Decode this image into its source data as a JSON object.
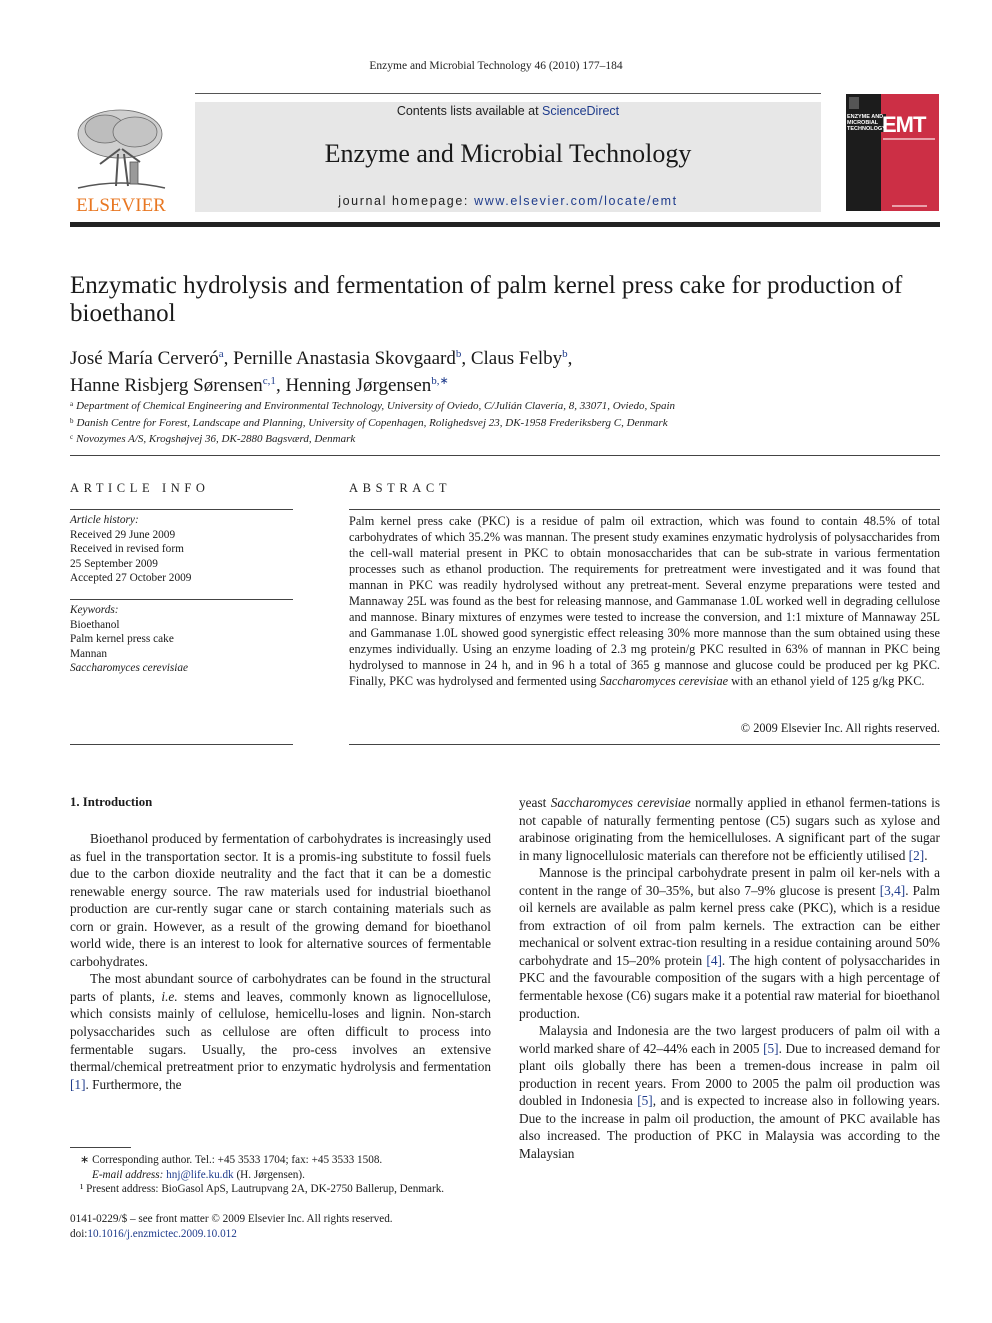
{
  "header": {
    "running_head": "Enzyme and Microbial Technology 46 (2010) 177–184",
    "contents_prefix": "Contents lists available at ",
    "contents_link": "ScienceDirect",
    "journal_title": "Enzyme and Microbial Technology",
    "homepage_prefix": "journal homepage: ",
    "homepage_url": "www.elsevier.com/locate/emt",
    "publisher_logo_text": "ELSEVIER",
    "cover": {
      "label_lines": [
        "ENZYME AND",
        "MICROBIAL",
        "TECHNOLOGY"
      ],
      "abbrev": "EMT",
      "colors": {
        "red": "#cc2f45",
        "dark": "#1c1c1c"
      }
    }
  },
  "colors": {
    "link": "#1f3c8c",
    "elsevier_orange": "#e87722"
  },
  "article": {
    "title": "Enzymatic hydrolysis and fermentation of palm kernel press cake for production of bioethanol",
    "authors": [
      {
        "name": "José María Cerveró",
        "sup": "a",
        "sep": ", "
      },
      {
        "name": "Pernille Anastasia Skovgaard",
        "sup": "b",
        "sep": ", "
      },
      {
        "name": "Claus Felby",
        "sup": "b",
        "sep": ","
      },
      {
        "name": "Hanne Risbjerg Sørensen",
        "sup": "c,1",
        "sep": ", "
      },
      {
        "name": "Henning Jørgensen",
        "sup": "b,∗",
        "sep": ""
      }
    ],
    "affiliations": [
      {
        "key": "a",
        "text": "Department of Chemical Engineering and Environmental Technology, University of Oviedo, C/Julián Clavería, 8, 33071, Oviedo, Spain"
      },
      {
        "key": "b",
        "text": "Danish Centre for Forest, Landscape and Planning, University of Copenhagen, Rolighedsvej 23, DK-1958 Frederiksberg C, Denmark"
      },
      {
        "key": "c",
        "text": "Novozymes A/S, Krogshøjvej 36, DK-2880 Bagsværd, Denmark"
      }
    ]
  },
  "article_info": {
    "heading": "ARTICLE INFO",
    "history_label": "Article history:",
    "history": [
      "Received 29 June 2009",
      "Received in revised form",
      "25 September 2009",
      "Accepted 27 October 2009"
    ],
    "keywords_label": "Keywords:",
    "keywords": [
      "Bioethanol",
      "Palm kernel press cake",
      "Mannan",
      "Saccharomyces cerevisiae"
    ]
  },
  "abstract": {
    "heading": "ABSTRACT",
    "part1": "Palm kernel press cake (PKC) is a residue of palm oil extraction, which was found to contain 48.5% of total carbohydrates of which 35.2% was mannan. The present study examines enzymatic hydrolysis of polysaccharides from the cell-wall material present in PKC to obtain monosaccharides that can be sub-strate in various fermentation processes such as ethanol production. The requirements for pretreatment were investigated and it was found that mannan in PKC was readily hydrolysed without any pretreat-ment. Several enzyme preparations were tested and Mannaway 25L was found as the best for releasing mannose, and Gammanase 1.0L worked well in degrading cellulose and mannose. Binary mixtures of enzymes were tested to increase the conversion, and 1:1 mixture of Mannaway 25L and Gammanase 1.0L showed good synergistic effect releasing 30% more mannose than the sum obtained using these enzymes individually. Using an enzyme loading of 2.3 mg protein/g PKC resulted in 63% of mannan in PKC being hydrolysed to mannose in 24 h, and in 96 h a total of 365 g mannose and glucose could be produced per kg PKC. Finally, PKC was hydrolysed and fermented using ",
    "italic": "Saccharomyces cerevisiae",
    "part2": " with an ethanol yield of 125 g/kg PKC.",
    "copyright": "© 2009 Elsevier Inc. All rights reserved."
  },
  "body": {
    "section_heading": "1.  Introduction",
    "left": {
      "p1": "Bioethanol produced by fermentation of carbohydrates is increasingly used as fuel in the transportation sector. It is a promis-ing substitute to fossil fuels due to the carbon dioxide neutrality and the fact that it can be a domestic renewable energy source. The raw materials used for industrial bioethanol production are cur-rently sugar cane or starch containing materials such as corn or grain. However, as a result of the growing demand for bioethanol world wide, there is an interest to look for alternative sources of fermentable carbohydrates.",
      "p2_a": "The most abundant source of carbohydrates can be found in the structural parts of plants, ",
      "p2_ie": "i.e.",
      "p2_b": " stems and leaves, commonly known as lignocellulose, which consists mainly of cellulose, hemicellu-loses and lignin. Non-starch polysaccharides such as cellulose are often difficult to process into fermentable sugars. Usually, the pro-cess involves an extensive thermal/chemical pretreatment prior to enzymatic hydrolysis and fermentation ",
      "p2_ref": "[1]",
      "p2_c": ". Furthermore, the"
    },
    "right": {
      "p1_a": "yeast ",
      "p1_italic": "Saccharomyces cerevisiae",
      "p1_b": " normally applied in ethanol fermen-tations is not capable of naturally fermenting pentose (C5) sugars such as xylose and arabinose originating from the hemicelluloses. A significant part of the sugar in many lignocellulosic materials can therefore not be efficiently utilised ",
      "p1_ref": "[2]",
      "p1_c": ".",
      "p2_a": "Mannose is the principal carbohydrate present in palm oil ker-nels with a content in the range of 30–35%, but also 7–9% glucose is present ",
      "p2_ref1": "[3,4]",
      "p2_b": ". Palm oil kernels are available as palm kernel press cake (PKC), which is a residue from extraction of oil from palm kernels. The extraction can be either mechanical or solvent extrac-tion resulting in a residue containing around 50% carbohydrate and 15–20% protein ",
      "p2_ref2": "[4]",
      "p2_c": ". The high content of polysaccharides in PKC and the favourable composition of the sugars with a high percentage of fermentable hexose (C6) sugars make it a potential raw material for bioethanol production.",
      "p3_a": "Malaysia and Indonesia are the two largest producers of palm oil with a world marked share of 42–44% each in 2005 ",
      "p3_ref1": "[5]",
      "p3_b": ". Due to increased demand for plant oils globally there has been a tremen-dous increase in palm oil production in recent years. From 2000 to 2005 the palm oil production was doubled in Indonesia ",
      "p3_ref2": "[5]",
      "p3_c": ", and is expected to increase also in following years. Due to the increase in palm oil production, the amount of PKC available has also increased. The production of PKC in Malaysia was according to the Malaysian"
    }
  },
  "footnotes": {
    "corresponding": "∗  Corresponding author. Tel.: +45 3533 1704; fax: +45 3533 1508.",
    "email_label": "E-mail address: ",
    "email": "hnj@life.ku.dk",
    "email_suffix": " (H. Jørgensen).",
    "present_address": "¹ Present address: BioGasol ApS, Lautrupvang 2A, DK-2750 Ballerup, Denmark."
  },
  "front_matter": {
    "issn_line": "0141-0229/$ – see front matter © 2009 Elsevier Inc. All rights reserved.",
    "doi_prefix": "doi:",
    "doi": "10.1016/j.enzmictec.2009.10.012"
  }
}
